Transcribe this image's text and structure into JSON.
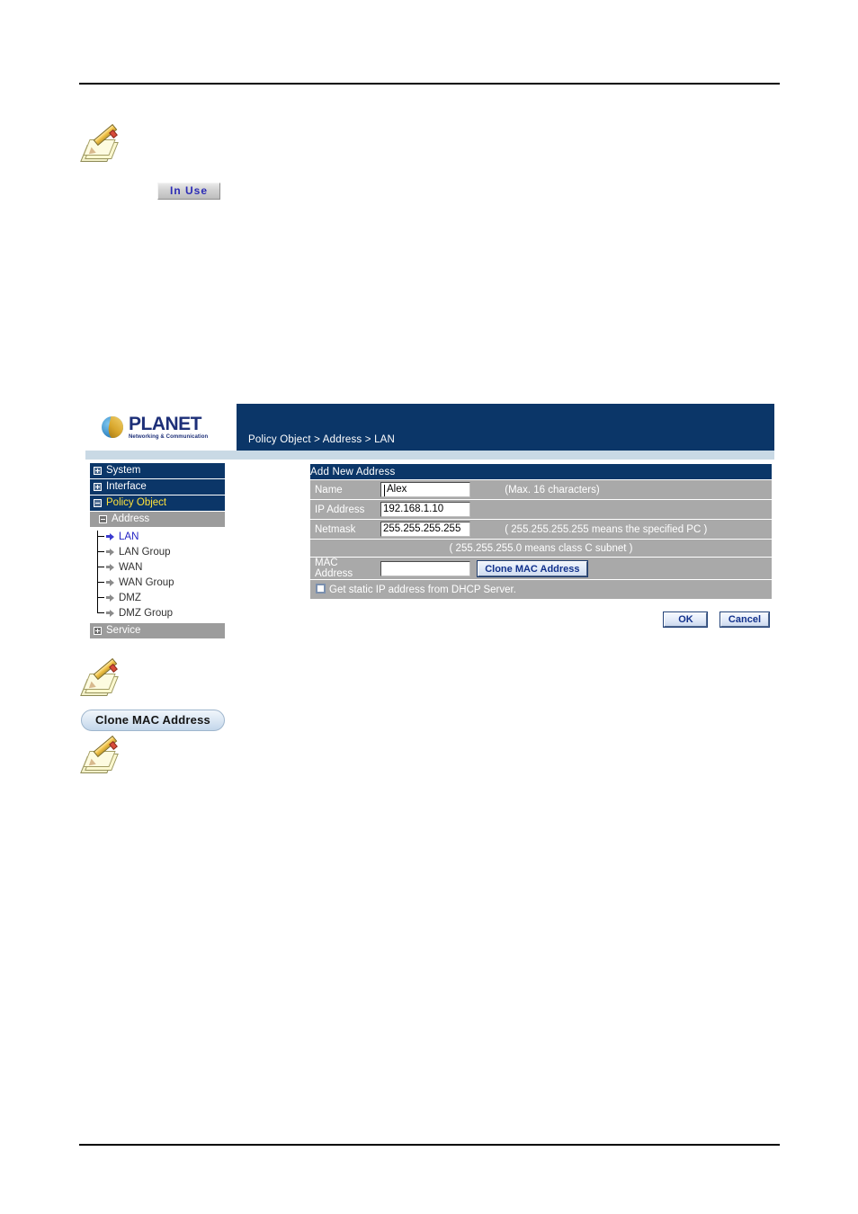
{
  "page": {
    "rules": [
      "top-rule",
      "bottom-rule"
    ]
  },
  "annotations": {
    "note_icon_name": "note-pencil-icon",
    "in_use_label": "In  Use",
    "clone_mac_pill_label": "Clone MAC Address"
  },
  "device_ui": {
    "logo": {
      "wordmark": "PLANET",
      "tagline": "Networking & Communication"
    },
    "breadcrumb": "Policy Object > Address > LAN",
    "sidebar": {
      "top_items": [
        {
          "label": "System",
          "state": "collapsed"
        },
        {
          "label": "Interface",
          "state": "collapsed"
        },
        {
          "label": "Policy Object",
          "state": "expanded"
        }
      ],
      "group": {
        "label": "Address",
        "state": "expanded"
      },
      "sub_items": [
        {
          "label": "LAN",
          "active": true
        },
        {
          "label": "LAN Group",
          "active": false
        },
        {
          "label": "WAN",
          "active": false
        },
        {
          "label": "WAN Group",
          "active": false
        },
        {
          "label": "DMZ",
          "active": false
        },
        {
          "label": "DMZ Group",
          "active": false
        }
      ],
      "bottom_item": {
        "label": "Service",
        "state": "collapsed"
      }
    },
    "form": {
      "title": "Add New Address",
      "rows": {
        "name": {
          "label": "Name",
          "value": "Alex",
          "placeholder": "",
          "hint": "(Max. 16 characters)"
        },
        "ip_address": {
          "label": "IP Address",
          "value": "192.168.1.10",
          "placeholder": "",
          "hint": ""
        },
        "netmask": {
          "label": "Netmask",
          "value": "255.255.255.255",
          "placeholder": "",
          "hint": "( 255.255.255.255 means the specified PC )"
        },
        "netmask_note": "( 255.255.255.0 means class C subnet )",
        "mac_address": {
          "label": "MAC Address",
          "value": "",
          "placeholder": "",
          "button_label": "Clone MAC Address"
        },
        "dhcp": {
          "label": "Get static IP address from DHCP Server.",
          "checked": false
        }
      },
      "actions": {
        "ok_label": "OK",
        "cancel_label": "Cancel"
      }
    }
  },
  "colors": {
    "header_navy": "#0b3668",
    "underbar": "#c9d9e5",
    "row_gray": "#a9a9a9",
    "nav_gray": "#9c9c9c",
    "active_yellow": "#ffe23b",
    "active_blue": "#2222c4",
    "button_text_blue": "#11318c"
  }
}
